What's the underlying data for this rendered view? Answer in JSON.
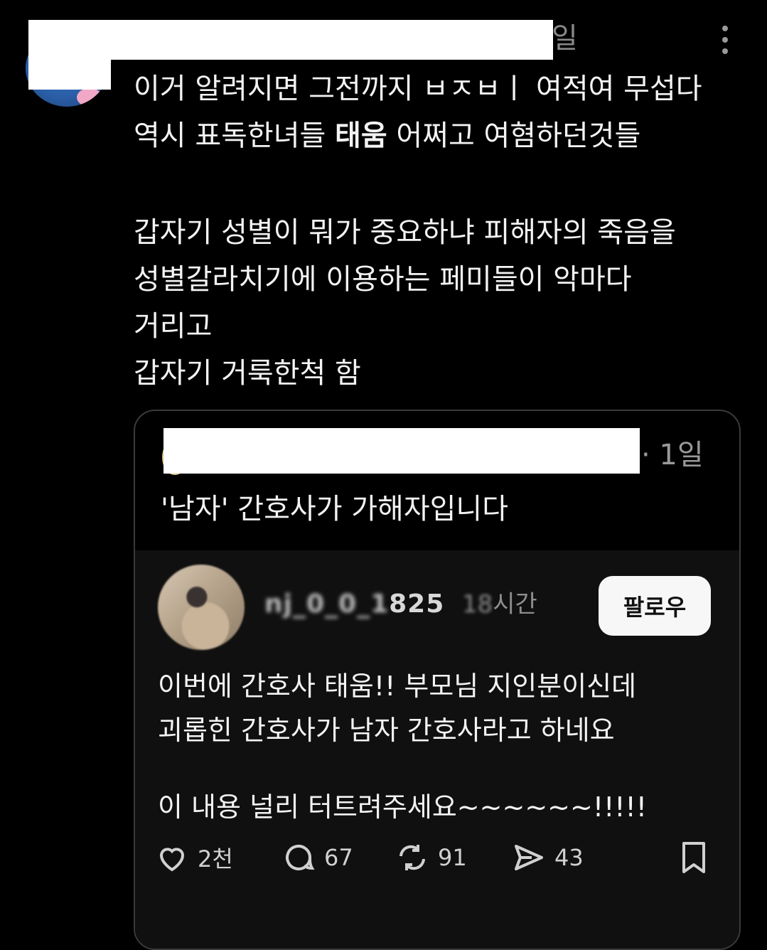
{
  "outer_post": {
    "time_tail": "일",
    "lines": [
      "이거 알려지면 그전까지 ㅂㅈㅂㅣ 여적여 무섭다",
      "역시 표독한녀들 ",
      "태움",
      " 어쩌고 여혐하던것들",
      "갑자기 성별이 뭐가 중요하냐 피해자의 죽음을",
      "성별갈라치기에 이용하는 페미들이 악마다",
      "거리고",
      "갑자기 거룩한척 함"
    ]
  },
  "quote": {
    "time": "· 1일",
    "text": "'남자' 간호사가 가해자입니다",
    "embed": {
      "username_blur_prefix": "nj_0_0_1",
      "username_rest": "825",
      "time_blur": "18",
      "time_rest": "시간",
      "follow_label": "팔로우",
      "lines": [
        "이번에 간호사 태움!! 부모님 지인분이신데",
        "괴롭힌 간호사가 남자 간호사라고 하네요",
        "이 내용 널리 터트려주세요~~~~~~!!!!!"
      ],
      "actions": {
        "likes": "2천",
        "replies": "67",
        "reposts": "91",
        "shares": "43"
      }
    }
  },
  "colors": {
    "background": "#000000",
    "text": "#f3f3f3",
    "muted": "#8d8d8d",
    "card_border": "#3a3a3a",
    "embed_bg": "#101010"
  },
  "icons": [
    "more-icon",
    "heart-icon",
    "reply-icon",
    "repost-icon",
    "share-icon",
    "bookmark-icon"
  ]
}
